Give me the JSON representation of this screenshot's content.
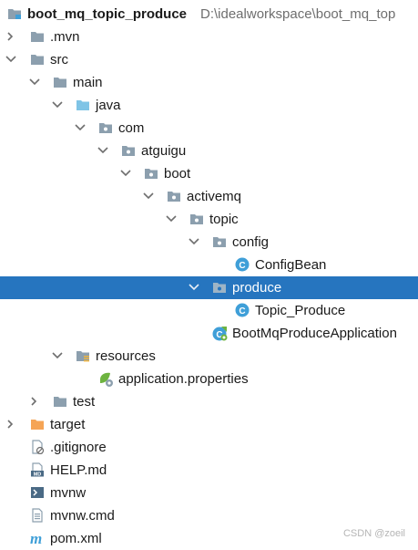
{
  "project": {
    "name": "boot_mq_topic_produce",
    "path": "D:\\idealworkspace\\boot_mq_top"
  },
  "nodes": [
    {
      "label": "boot_mq_topic_produce",
      "expander": "none",
      "icon": "module-folder-icon"
    },
    {
      "label": ".mvn",
      "expander": "collapsed",
      "icon": "folder-icon"
    },
    {
      "label": "src",
      "expander": "expanded",
      "icon": "folder-icon"
    },
    {
      "label": "main",
      "expander": "expanded",
      "icon": "folder-icon"
    },
    {
      "label": "java",
      "expander": "expanded",
      "icon": "source-folder-icon"
    },
    {
      "label": "com",
      "expander": "expanded",
      "icon": "package-icon"
    },
    {
      "label": "atguigu",
      "expander": "expanded",
      "icon": "package-icon"
    },
    {
      "label": "boot",
      "expander": "expanded",
      "icon": "package-icon"
    },
    {
      "label": "activemq",
      "expander": "expanded",
      "icon": "package-icon"
    },
    {
      "label": "topic",
      "expander": "expanded",
      "icon": "package-icon"
    },
    {
      "label": "config",
      "expander": "expanded",
      "icon": "package-icon"
    },
    {
      "label": "ConfigBean",
      "expander": "none",
      "icon": "class-icon"
    },
    {
      "label": "produce",
      "expander": "expanded",
      "icon": "package-icon",
      "selected": true
    },
    {
      "label": "Topic_Produce",
      "expander": "none",
      "icon": "class-icon"
    },
    {
      "label": "BootMqProduceApplication",
      "expander": "none",
      "icon": "spring-boot-class-icon"
    },
    {
      "label": "resources",
      "expander": "expanded",
      "icon": "resources-folder-icon"
    },
    {
      "label": "application.properties",
      "expander": "none",
      "icon": "spring-properties-icon"
    },
    {
      "label": "test",
      "expander": "collapsed",
      "icon": "folder-icon"
    },
    {
      "label": "target",
      "expander": "collapsed",
      "icon": "excluded-folder-icon"
    },
    {
      "label": ".gitignore",
      "expander": "none",
      "icon": "ignore-file-icon"
    },
    {
      "label": "HELP.md",
      "expander": "none",
      "icon": "markdown-file-icon"
    },
    {
      "label": "mvnw",
      "expander": "none",
      "icon": "shell-script-icon"
    },
    {
      "label": "mvnw.cmd",
      "expander": "none",
      "icon": "text-file-icon"
    },
    {
      "label": "pom.xml",
      "expander": "none",
      "icon": "maven-pom-icon"
    }
  ],
  "watermark": "CSDN @zoeil",
  "colors": {
    "selection": "#2675bf",
    "folder": "#8c9fae",
    "source_folder": "#7fc4e6",
    "excluded_folder": "#f5a455",
    "class": "#3f9fd8",
    "spring": "#6db33f"
  }
}
